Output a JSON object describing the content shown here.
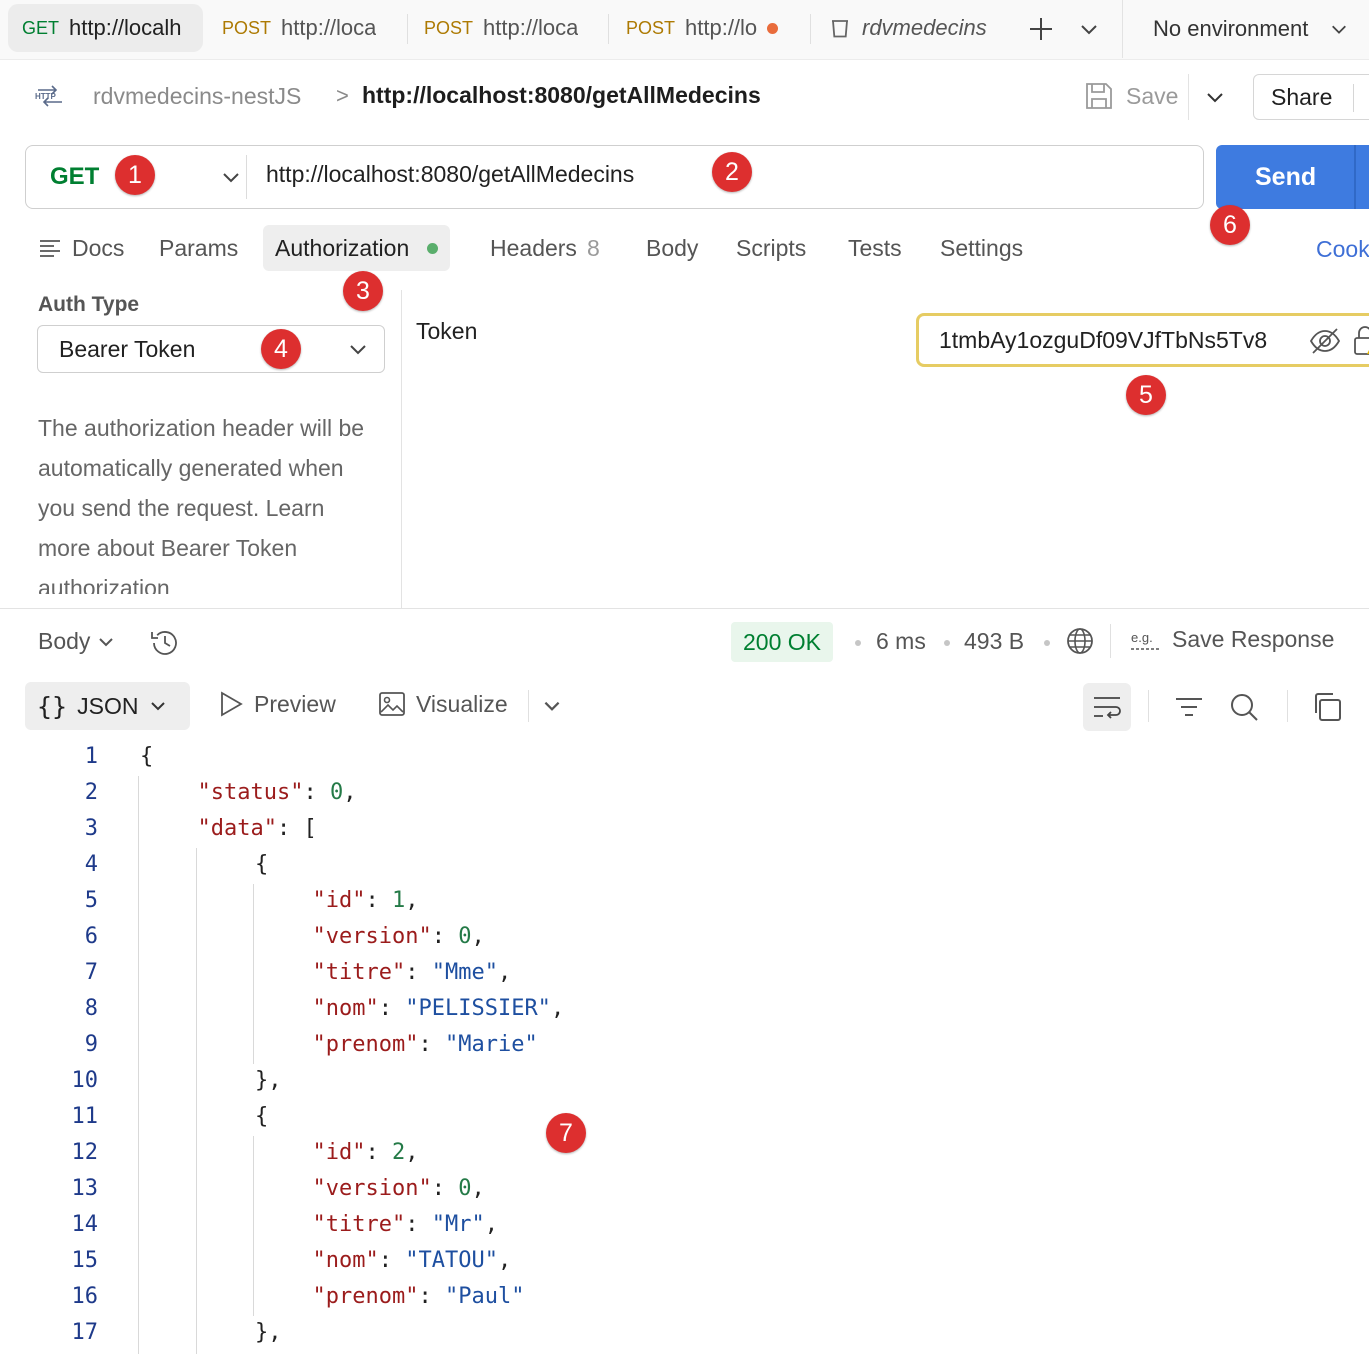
{
  "tabs": [
    {
      "method": "GET",
      "url": "http://localh"
    },
    {
      "method": "POST",
      "url": "http://loca"
    },
    {
      "method": "POST",
      "url": "http://loca"
    },
    {
      "method": "POST",
      "url": "http://lo"
    },
    {
      "name": "rdvmedecins"
    }
  ],
  "environment": "No environment",
  "breadcrumb": {
    "parent": "rdvmedecins-nestJS",
    "separator": ">",
    "current": "http://localhost:8080/getAllMedecins",
    "badge": "HTTP"
  },
  "actions": {
    "save": "Save",
    "share": "Share",
    "send": "Send"
  },
  "request": {
    "method": "GET",
    "url": "http://localhost:8080/getAllMedecins"
  },
  "request_tabs": [
    {
      "label": "Docs"
    },
    {
      "label": "Params"
    },
    {
      "label": "Authorization"
    },
    {
      "label": "Headers",
      "count": "8"
    },
    {
      "label": "Body"
    },
    {
      "label": "Scripts"
    },
    {
      "label": "Tests"
    },
    {
      "label": "Settings"
    }
  ],
  "cookies_label": "Cook",
  "auth": {
    "label": "Auth Type",
    "type": "Bearer Token",
    "help": "The authorization header will be automatically generated when you send the request. Learn more about",
    "help_more": "Bearer Token authorization",
    "token_label": "Token",
    "token_value": "1tmbAy1ozguDf09VJfTbNs5Tv8"
  },
  "response": {
    "body_label": "Body",
    "status": "200 OK",
    "time": "6 ms",
    "size": "493 B",
    "save_response": "Save Response",
    "format": "JSON",
    "preview": "Preview",
    "visualize": "Visualize"
  },
  "code_lines": [
    {
      "n": "1",
      "indent": 0,
      "parts": [
        [
          "p",
          "{"
        ]
      ]
    },
    {
      "n": "2",
      "indent": 1,
      "parts": [
        [
          "k",
          "\"status\""
        ],
        [
          "p",
          ": "
        ],
        [
          "n",
          "0"
        ],
        [
          "p",
          ","
        ]
      ]
    },
    {
      "n": "3",
      "indent": 1,
      "parts": [
        [
          "k",
          "\"data\""
        ],
        [
          "p",
          ": ["
        ]
      ]
    },
    {
      "n": "4",
      "indent": 2,
      "parts": [
        [
          "p",
          "{"
        ]
      ]
    },
    {
      "n": "5",
      "indent": 3,
      "parts": [
        [
          "k",
          "\"id\""
        ],
        [
          "p",
          ": "
        ],
        [
          "n",
          "1"
        ],
        [
          "p",
          ","
        ]
      ]
    },
    {
      "n": "6",
      "indent": 3,
      "parts": [
        [
          "k",
          "\"version\""
        ],
        [
          "p",
          ": "
        ],
        [
          "n",
          "0"
        ],
        [
          "p",
          ","
        ]
      ]
    },
    {
      "n": "7",
      "indent": 3,
      "parts": [
        [
          "k",
          "\"titre\""
        ],
        [
          "p",
          ": "
        ],
        [
          "s",
          "\"Mme\""
        ],
        [
          "p",
          ","
        ]
      ]
    },
    {
      "n": "8",
      "indent": 3,
      "parts": [
        [
          "k",
          "\"nom\""
        ],
        [
          "p",
          ": "
        ],
        [
          "s",
          "\"PELISSIER\""
        ],
        [
          "p",
          ","
        ]
      ]
    },
    {
      "n": "9",
      "indent": 3,
      "parts": [
        [
          "k",
          "\"prenom\""
        ],
        [
          "p",
          ": "
        ],
        [
          "s",
          "\"Marie\""
        ]
      ]
    },
    {
      "n": "10",
      "indent": 2,
      "parts": [
        [
          "p",
          "},"
        ]
      ]
    },
    {
      "n": "11",
      "indent": 2,
      "parts": [
        [
          "p",
          "{"
        ]
      ]
    },
    {
      "n": "12",
      "indent": 3,
      "parts": [
        [
          "k",
          "\"id\""
        ],
        [
          "p",
          ": "
        ],
        [
          "n",
          "2"
        ],
        [
          "p",
          ","
        ]
      ]
    },
    {
      "n": "13",
      "indent": 3,
      "parts": [
        [
          "k",
          "\"version\""
        ],
        [
          "p",
          ": "
        ],
        [
          "n",
          "0"
        ],
        [
          "p",
          ","
        ]
      ]
    },
    {
      "n": "14",
      "indent": 3,
      "parts": [
        [
          "k",
          "\"titre\""
        ],
        [
          "p",
          ": "
        ],
        [
          "s",
          "\"Mr\""
        ],
        [
          "p",
          ","
        ]
      ]
    },
    {
      "n": "15",
      "indent": 3,
      "parts": [
        [
          "k",
          "\"nom\""
        ],
        [
          "p",
          ": "
        ],
        [
          "s",
          "\"TATOU\""
        ],
        [
          "p",
          ","
        ]
      ]
    },
    {
      "n": "16",
      "indent": 3,
      "parts": [
        [
          "k",
          "\"prenom\""
        ],
        [
          "p",
          ": "
        ],
        [
          "s",
          "\"Paul\""
        ]
      ]
    },
    {
      "n": "17",
      "indent": 2,
      "parts": [
        [
          "p",
          "},"
        ]
      ]
    }
  ],
  "markers": [
    "1",
    "2",
    "3",
    "4",
    "5",
    "6",
    "7"
  ],
  "colors": {
    "accent": "#3e7be0",
    "get": "#007f31",
    "post": "#ad7a03",
    "marker": "#dd2f2f",
    "status_ok": "#007f31",
    "token_border": "#e6cc63"
  }
}
